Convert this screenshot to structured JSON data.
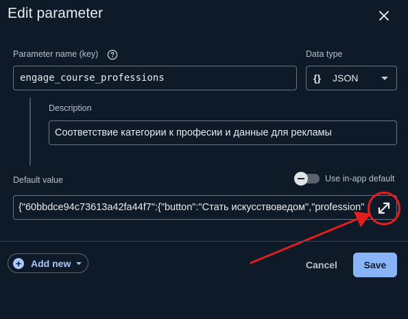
{
  "dialog": {
    "title": "Edit parameter"
  },
  "param_name": {
    "label": "Parameter name (key)",
    "value": "engage_course_professions"
  },
  "data_type": {
    "label": "Data type",
    "selected": "JSON",
    "icon": "{}"
  },
  "description": {
    "label": "Description",
    "value": "Соответствие категории к професии и данные для рекламы"
  },
  "default_value": {
    "label": "Default value",
    "value": "{\"60bbdce94c73613a42fa44f7\":{\"button\":\"Стать искусствоведом\",\"profession\""
  },
  "in_app_default": {
    "label": "Use in-app default"
  },
  "footer": {
    "add_new_label": "Add new",
    "cancel_label": "Cancel",
    "save_label": "Save"
  },
  "colors": {
    "background": "#0f1a29",
    "accent": "#8ab4f8",
    "annotation": "#e41e1e"
  }
}
